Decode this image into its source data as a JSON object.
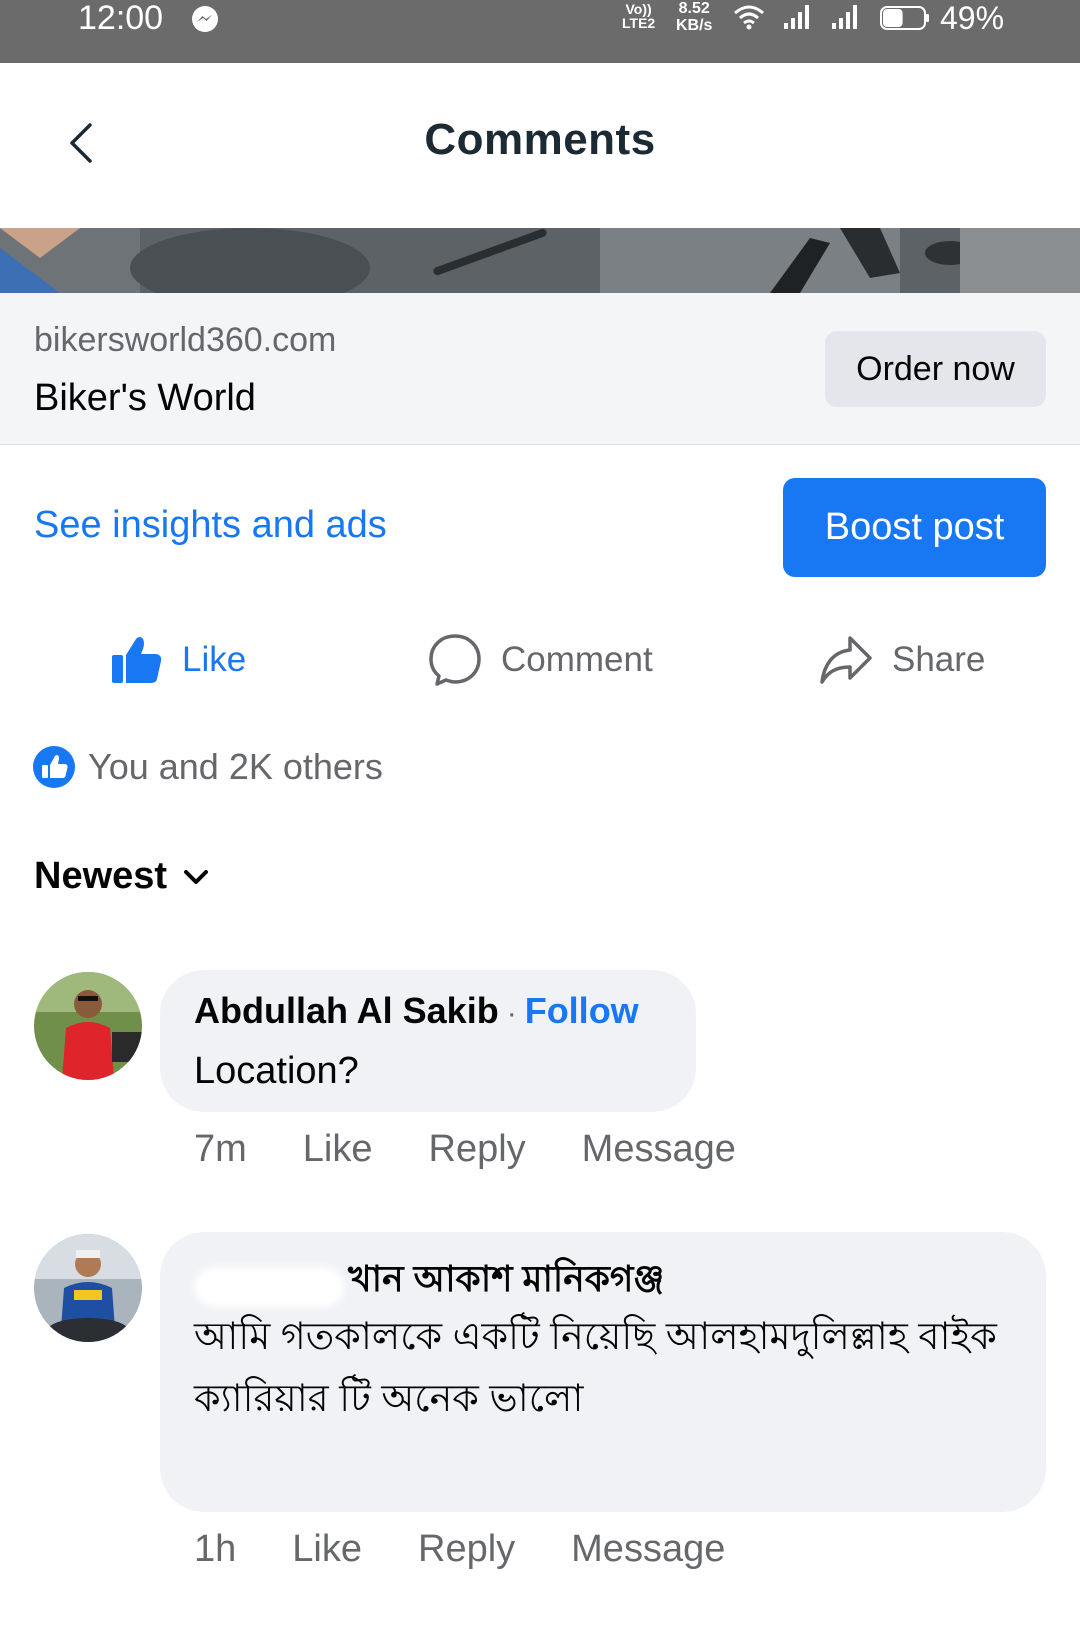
{
  "status_bar": {
    "time": "12:00",
    "volte_top": "Vo))",
    "volte_bottom": "LTE2",
    "speed_value": "8.52",
    "speed_unit": "KB/s",
    "battery": "49%",
    "battery_level": 0.49
  },
  "header": {
    "title": "Comments"
  },
  "link_card": {
    "domain": "bikersworld360.com",
    "name": "Biker's World",
    "cta_label": "Order now"
  },
  "insights": {
    "link_label": "See insights and ads",
    "boost_label": "Boost post"
  },
  "actions": {
    "like": "Like",
    "comment": "Comment",
    "share": "Share"
  },
  "reactions": {
    "summary": "You and 2K others"
  },
  "sort": {
    "label": "Newest"
  },
  "comments": [
    {
      "name": "Abdullah Al Sakib",
      "separator": "·",
      "follow": "Follow",
      "text": "Location?",
      "time": "7m",
      "like": "Like",
      "reply": "Reply",
      "message": "Message"
    },
    {
      "name_visible": "খান আকাশ মানিকগঞ্জ",
      "text": "আমি গতকালকে একটি নিয়েছি আলহামদুলিল্লাহ বাইক ক্যারিয়ার টি অনেক ভালো",
      "time": "1h",
      "like": "Like",
      "reply": "Reply",
      "message": "Message"
    }
  ],
  "colors": {
    "accent": "#1877f2",
    "status_bar": "#6b6b6b",
    "bubble": "#f0f2f5",
    "secondary_text": "#65676b"
  }
}
